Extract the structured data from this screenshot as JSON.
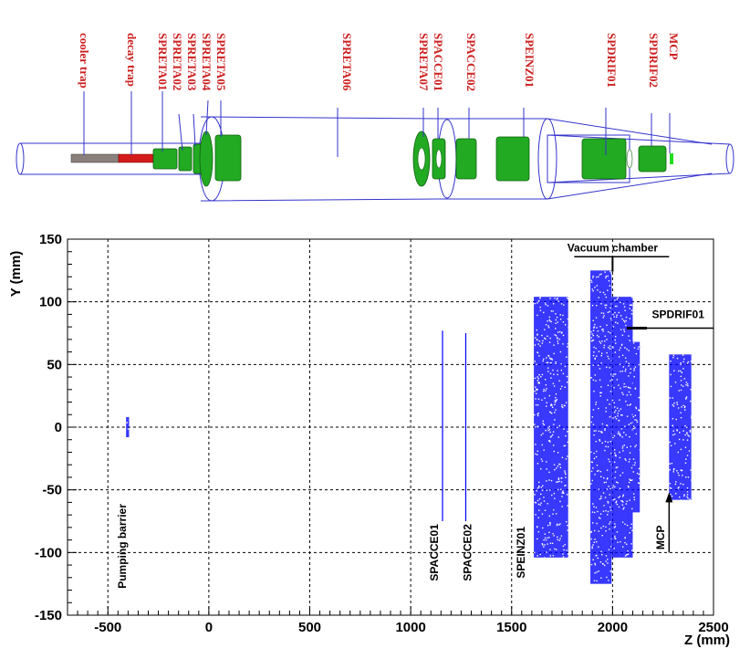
{
  "geometry_labels": [
    "cooler trap",
    "decay trap",
    "SPRETA01",
    "SPRETA02",
    "SPRETA03",
    "SPRETA04",
    "SPRETA05",
    "SPRETA06",
    "SPRETA07",
    "SPACCE01",
    "SPACCE02",
    "SPEINZ01",
    "SPDRIF01",
    "SPDRIF02",
    "MCP"
  ],
  "colors": {
    "label_red": "#cc1f1f",
    "outline_blue": "#3333cc",
    "electrode_green": "#22aa22",
    "trap_grey": "#8a7f7a",
    "trap_red": "#d41b1b",
    "hits_blue": "#0000ff"
  },
  "chart_data": {
    "type": "scatter",
    "xlabel": "Z (mm)",
    "ylabel": "Y (mm)",
    "xlim": [
      -700,
      2500
    ],
    "ylim": [
      -150,
      150
    ],
    "xticks": [
      -500,
      0,
      500,
      1000,
      1500,
      2000,
      2500
    ],
    "yticks": [
      -150,
      -100,
      -50,
      0,
      50,
      100,
      150
    ],
    "grid": true,
    "regions": [
      {
        "name": "Pumping barrier",
        "z": [
          -410,
          -395
        ],
        "y": [
          -8,
          8
        ]
      },
      {
        "name": "SPACCE01",
        "z": [
          1155,
          1160
        ],
        "y": [
          -75,
          77
        ]
      },
      {
        "name": "SPACCE02",
        "z": [
          1270,
          1275
        ],
        "y": [
          -75,
          75
        ]
      },
      {
        "name": "SPEINZ01",
        "z": [
          1610,
          1780
        ],
        "y": [
          -104,
          104
        ]
      },
      {
        "name": "Vacuum chamber",
        "z": [
          1890,
          1995
        ],
        "y": [
          -125,
          125
        ]
      },
      {
        "name": "SPDRIF01",
        "z": [
          1995,
          2100
        ],
        "y": [
          -104,
          104
        ]
      },
      {
        "name": "SPDRIF02",
        "z": [
          2100,
          2135
        ],
        "y": [
          -68,
          68
        ]
      },
      {
        "name": "MCP",
        "z": [
          2280,
          2390
        ],
        "y": [
          -58,
          58
        ]
      }
    ],
    "annotations": [
      {
        "text": "Pumping barrier",
        "z": -410,
        "y": -100
      },
      {
        "text": "SPACCE01",
        "z": 1130,
        "y": -100
      },
      {
        "text": "SPACCE02",
        "z": 1295,
        "y": -100
      },
      {
        "text": "SPEINZ01",
        "z": 1560,
        "y": -100
      },
      {
        "text": "Vacuum chamber",
        "z": 2000,
        "y": 140
      },
      {
        "text": "SPDRIF01",
        "z": 2200,
        "y": 87
      },
      {
        "text": "MCP",
        "z": 2235,
        "y": -95
      }
    ]
  }
}
